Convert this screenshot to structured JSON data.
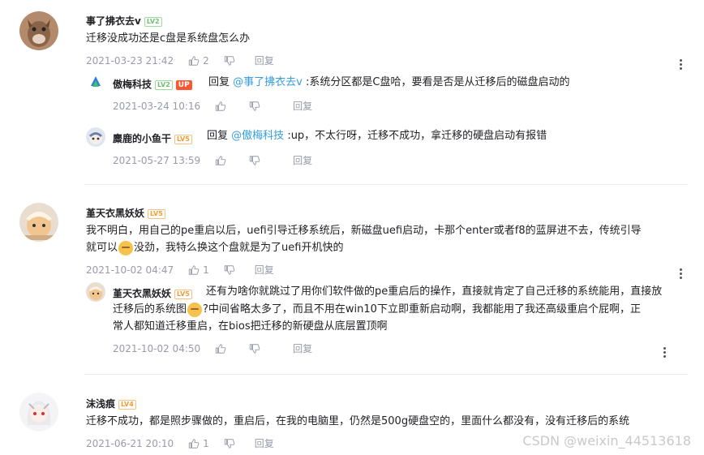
{
  "comments": [
    {
      "user": "事了拂衣去v",
      "level": "LV2",
      "text": "迁移没成功还是c盘是系统盘怎么办",
      "time": "2021-03-23 21:42",
      "likes": "2",
      "reply_label": "回复",
      "replies": [
        {
          "user": "傲梅科技",
          "level": "LV2",
          "badge": "UP",
          "reply_prefix": "回复",
          "mention": "@事了拂衣去v",
          "text": ":系统分区都是C盘哈，要看是否是从迁移后的磁盘启动的",
          "time": "2021-03-24 10:16",
          "reply_label": "回复"
        },
        {
          "user": "麋鹿的小鱼干",
          "level": "LV5",
          "reply_prefix": "回复",
          "mention": "@傲梅科技",
          "text": ":up，不太行呀，迁移不成功，拿迁移的硬盘启动有报错",
          "time": "2021-05-27 13:59",
          "reply_label": "回复"
        }
      ]
    },
    {
      "user": "堇天衣黑妖妖",
      "level": "LV5",
      "text_line1": "我不明白，用自己的pe重启以后，uefi引导迁移系统后，新磁盘uefi启动，卡那个enter或者f8的蓝屏进不去，传统引导",
      "text_line2a": "就可以",
      "text_line2b": "没劲，我特么换这个盘就是为了uefi开机快的",
      "time": "2021-10-02 04:47",
      "likes": "1",
      "reply_label": "回复",
      "replies": [
        {
          "user": "堇天衣黑妖妖",
          "level": "LV5",
          "text_line1": "还有为啥你就跳过了用你们软件做的pe重启后的操作，直接就肯定了自己迁移的系统能用，直接放",
          "text_line2a": "迁移后的系统图",
          "text_line2b": "?中间省略太多了，而且不用在win10下立即重新启动啊，我都能用了我还高级重启个屁啊，正",
          "text_line3": "常人都知道迁移重启，在bios把迁移的新硬盘从底层置顶啊",
          "time": "2021-10-02 04:50",
          "reply_label": "回复"
        }
      ]
    },
    {
      "user": "沫浅痕",
      "level": "LV4",
      "text": "迁移不成功，都是照步骤做的，重启后，在我的电脑里，仍然是500g硬盘空的，里面什么都没有，没有迁移后的系统",
      "time": "2021-06-21 20:10",
      "likes": "1",
      "reply_label": "回复"
    }
  ],
  "watermark": "CSDN @weixin_44513618",
  "colors": {
    "mention": "#349edf",
    "meta": "#999aaa",
    "up_badge": "#fc5531"
  }
}
